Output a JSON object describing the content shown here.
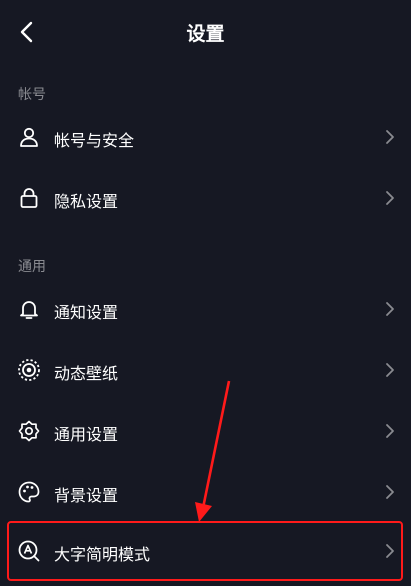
{
  "header": {
    "title": "设置",
    "back_icon": "chevron-left-icon"
  },
  "sections": [
    {
      "label": "帐号",
      "items": [
        {
          "label": "帐号与安全",
          "icon": "user-icon"
        },
        {
          "label": "隐私设置",
          "icon": "lock-icon"
        }
      ]
    },
    {
      "label": "通用",
      "items": [
        {
          "label": "通知设置",
          "icon": "bell-icon"
        },
        {
          "label": "动态壁纸",
          "icon": "live-wallpaper-icon"
        },
        {
          "label": "通用设置",
          "icon": "gear-icon"
        },
        {
          "label": "背景设置",
          "icon": "palette-icon"
        },
        {
          "label": "大字简明模式",
          "icon": "large-text-mode-icon"
        }
      ]
    }
  ],
  "colors": {
    "background": "#161823",
    "text": "#ffffff",
    "section_label": "#8a8b91",
    "chevron": "#8a8b91",
    "annotation": "#ff1a1a"
  }
}
